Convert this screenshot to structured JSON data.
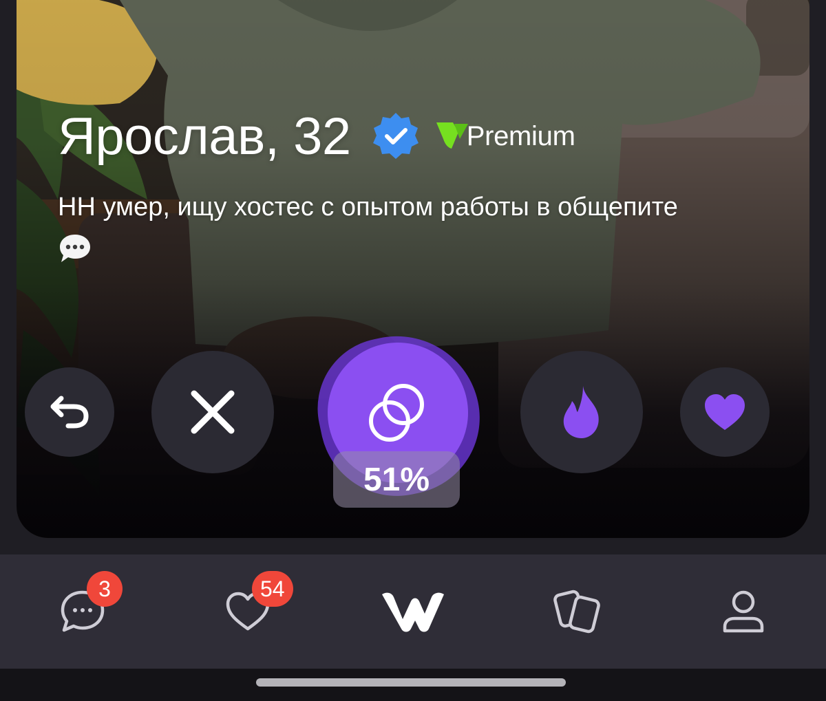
{
  "profile": {
    "name_age": "Ярослав, 32",
    "premium_label": "Premium",
    "bio": "НН умер, ищу хостес с опытом работы в общепите"
  },
  "actions": {
    "match_percent": "51%",
    "match_fraction": 0.51
  },
  "nav": {
    "chats_badge": "3",
    "likes_badge": "54"
  },
  "icons": {
    "verified": "verified-badge-icon",
    "premium": "premium-logo-icon",
    "bio": "speech-bubble-icon",
    "undo": "undo-icon",
    "nope": "close-icon",
    "match": "rings-icon",
    "superlike": "flame-icon",
    "like": "heart-icon",
    "nav_chats": "chat-icon",
    "nav_likes": "heart-outline-icon",
    "nav_home": "app-logo-icon",
    "nav_cards": "cards-icon",
    "nav_profile": "person-icon"
  },
  "colors": {
    "accent": "#8b4ff1",
    "verified_blue": "#3d8ef0",
    "premium_green": "#76e020",
    "badge_red": "#f0473a",
    "nav_bg": "#2f2d37"
  }
}
